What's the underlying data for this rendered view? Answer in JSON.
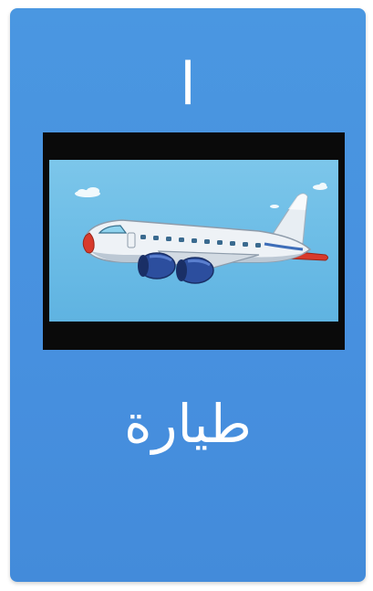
{
  "card": {
    "letter": "ا",
    "word": "طيارة",
    "background_color": "#4790df",
    "text_color": "#ffffff"
  },
  "illustration": {
    "subject": "airplane",
    "frame_color": "#0a0a0a",
    "sky_color": "#6bbce6"
  }
}
